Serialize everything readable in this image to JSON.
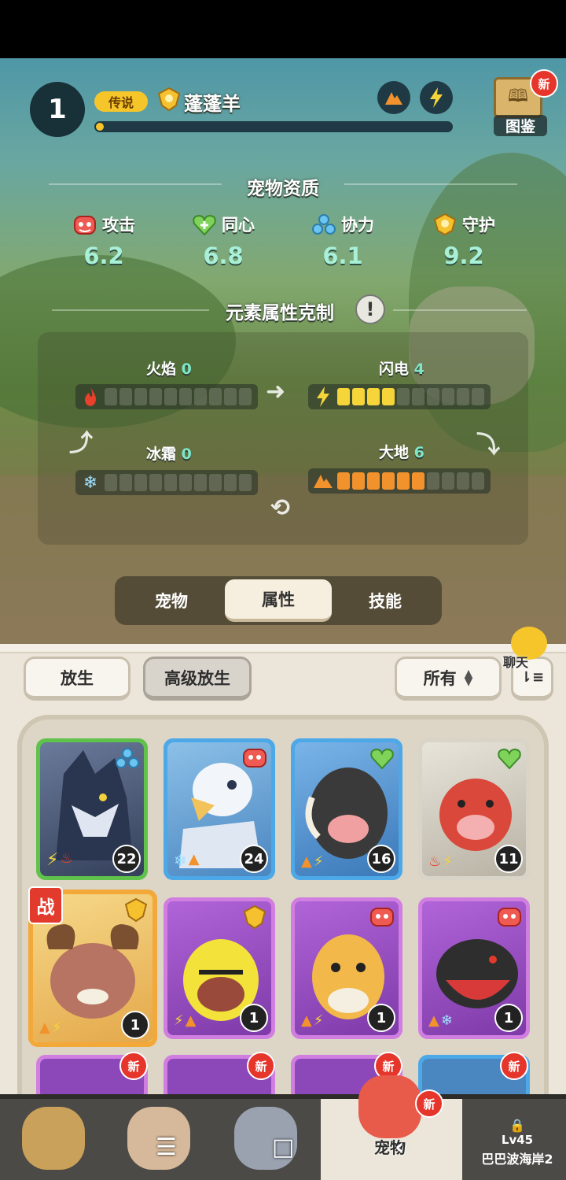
{
  "header": {
    "level": "1",
    "rarity": "传说",
    "pet_name": "蓬蓬羊",
    "xp_progress": 0.02,
    "book_label": "图鉴",
    "new_badge": "新"
  },
  "aptitude": {
    "title": "宠物资质",
    "stats": [
      {
        "label": "攻击",
        "value": "6.2",
        "icon": "attack-icon"
      },
      {
        "label": "同心",
        "value": "6.8",
        "icon": "heart-icon"
      },
      {
        "label": "协力",
        "value": "6.1",
        "icon": "cooperation-icon"
      },
      {
        "label": "守护",
        "value": "9.2",
        "icon": "guard-icon"
      }
    ]
  },
  "elements": {
    "title": "元素属性克制",
    "info_symbol": "!",
    "items": [
      {
        "name": "火焰",
        "value": "0",
        "filled": 0,
        "color": "#e8402a",
        "icon": "fire-icon"
      },
      {
        "name": "闪电",
        "value": "4",
        "filled": 4,
        "color": "#f5d53a",
        "icon": "lightning-icon"
      },
      {
        "name": "冰霜",
        "value": "0",
        "filled": 0,
        "color": "#7fd0f0",
        "icon": "frost-icon"
      },
      {
        "name": "大地",
        "value": "6",
        "filled": 6,
        "color": "#f2922c",
        "icon": "earth-icon"
      }
    ],
    "segments_total": 10
  },
  "tabs": [
    {
      "label": "宠物",
      "active": false
    },
    {
      "label": "属性",
      "active": true
    },
    {
      "label": "技能",
      "active": false
    }
  ],
  "toolbar": {
    "release": "放生",
    "advanced_release": "高级放生",
    "filter": "所有",
    "chat": "聊天"
  },
  "pets": [
    {
      "level": "22",
      "frame": "green",
      "badge": ""
    },
    {
      "level": "24",
      "frame": "blue",
      "badge": ""
    },
    {
      "level": "16",
      "frame": "blue",
      "badge": ""
    },
    {
      "level": "11",
      "frame": "white",
      "badge": ""
    },
    {
      "level": "1",
      "frame": "gold",
      "badge": "战"
    },
    {
      "level": "1",
      "frame": "purple",
      "badge": ""
    },
    {
      "level": "1",
      "frame": "purple",
      "badge": ""
    },
    {
      "level": "1",
      "frame": "purple",
      "badge": ""
    }
  ],
  "new_row_badges": [
    "新",
    "新",
    "新",
    "新"
  ],
  "nav": {
    "active_label": "宠物",
    "active_new": "新",
    "locked_level": "Lv45",
    "locked_area": "巴巴波海岸2"
  },
  "system_nav": [
    "☰",
    "□",
    "‹"
  ]
}
